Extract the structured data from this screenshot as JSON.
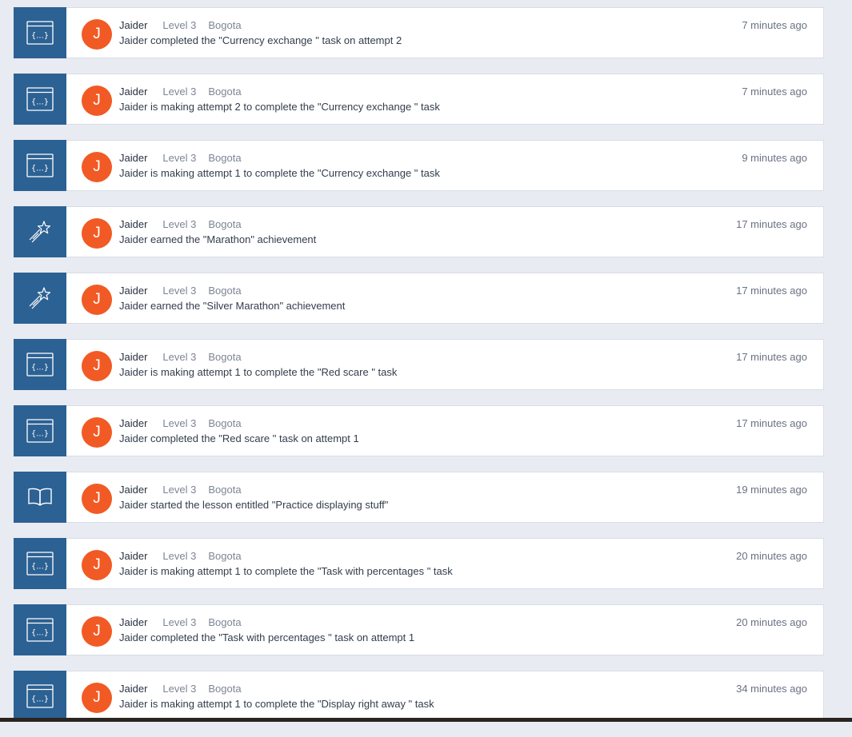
{
  "colors": {
    "page_bg": "#e8ebf2",
    "icon_panel": "#2c6193",
    "avatar": "#f15a24",
    "card_bg": "#ffffff"
  },
  "feed": [
    {
      "icon": "code-window-icon",
      "avatar_letter": "J",
      "name": "Jaider",
      "level": "Level 3",
      "city": "Bogota",
      "message": "Jaider completed the \"Currency exchange \" task on attempt 2",
      "time": "7 minutes ago"
    },
    {
      "icon": "code-window-icon",
      "avatar_letter": "J",
      "name": "Jaider",
      "level": "Level 3",
      "city": "Bogota",
      "message": "Jaider is making attempt 2 to complete the \"Currency exchange \" task",
      "time": "7 minutes ago"
    },
    {
      "icon": "code-window-icon",
      "avatar_letter": "J",
      "name": "Jaider",
      "level": "Level 3",
      "city": "Bogota",
      "message": "Jaider is making attempt 1 to complete the \"Currency exchange \" task",
      "time": "9 minutes ago"
    },
    {
      "icon": "shooting-star-icon",
      "avatar_letter": "J",
      "name": "Jaider",
      "level": "Level 3",
      "city": "Bogota",
      "message": "Jaider earned the \"Marathon\" achievement",
      "time": "17 minutes ago"
    },
    {
      "icon": "shooting-star-icon",
      "avatar_letter": "J",
      "name": "Jaider",
      "level": "Level 3",
      "city": "Bogota",
      "message": "Jaider earned the \"Silver Marathon\" achievement",
      "time": "17 minutes ago"
    },
    {
      "icon": "code-window-icon",
      "avatar_letter": "J",
      "name": "Jaider",
      "level": "Level 3",
      "city": "Bogota",
      "message": "Jaider is making attempt 1 to complete the \"Red scare \" task",
      "time": "17 minutes ago"
    },
    {
      "icon": "code-window-icon",
      "avatar_letter": "J",
      "name": "Jaider",
      "level": "Level 3",
      "city": "Bogota",
      "message": "Jaider completed the \"Red scare \" task on attempt 1",
      "time": "17 minutes ago"
    },
    {
      "icon": "open-book-icon",
      "avatar_letter": "J",
      "name": "Jaider",
      "level": "Level 3",
      "city": "Bogota",
      "message": "Jaider started the lesson entitled \"Practice displaying stuff\"",
      "time": "19 minutes ago"
    },
    {
      "icon": "code-window-icon",
      "avatar_letter": "J",
      "name": "Jaider",
      "level": "Level 3",
      "city": "Bogota",
      "message": "Jaider is making attempt 1 to complete the \"Task with percentages \" task",
      "time": "20 minutes ago"
    },
    {
      "icon": "code-window-icon",
      "avatar_letter": "J",
      "name": "Jaider",
      "level": "Level 3",
      "city": "Bogota",
      "message": "Jaider completed the \"Task with percentages \" task on attempt 1",
      "time": "20 minutes ago"
    },
    {
      "icon": "code-window-icon",
      "avatar_letter": "J",
      "name": "Jaider",
      "level": "Level 3",
      "city": "Bogota",
      "message": "Jaider is making attempt 1 to complete the \"Display right away \" task",
      "time": "34 minutes ago"
    }
  ]
}
